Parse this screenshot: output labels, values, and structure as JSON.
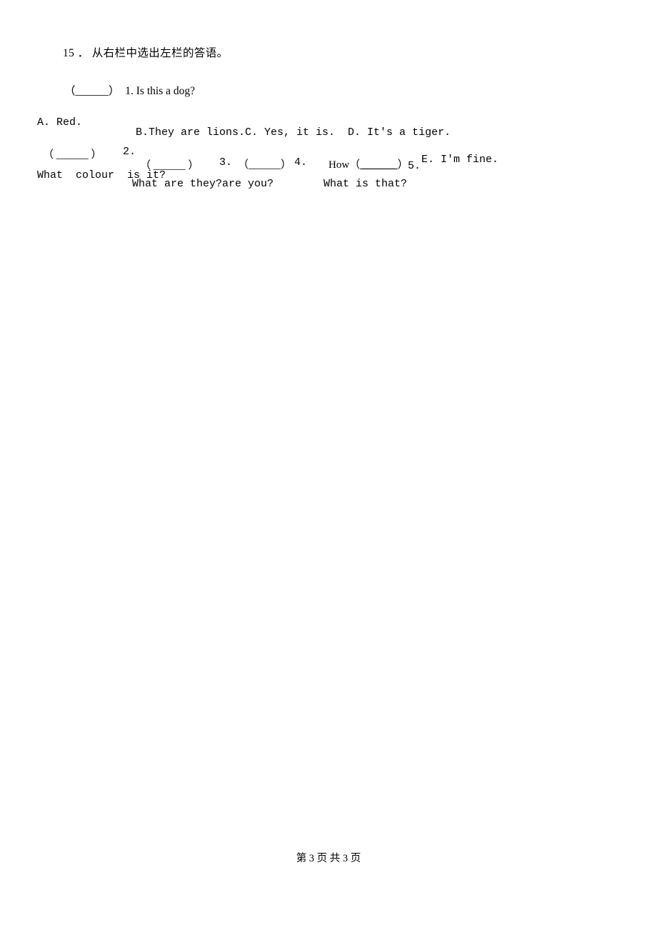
{
  "page": {
    "question_number_title": "15 ． 从右栏中选出左栏的答语。",
    "footer": "第 3 页 共 3 页"
  },
  "items": [
    {
      "paren": "（______）",
      "number": "1.",
      "text": "Is this a dog?"
    },
    {
      "paren": "（ ______ ）",
      "number": "2.",
      "text": "What  colour  is it?"
    },
    {
      "paren": "（ ______ ）",
      "number": "3.",
      "text": "What are they?"
    },
    {
      "paren": "（______）",
      "number": "4.",
      "text_before": "How（",
      "blank": " ______ ",
      "text_after": "）",
      "text": "are you?"
    },
    {
      "paren": "",
      "number": "5.",
      "text": "What is that?"
    }
  ],
  "options": {
    "a": "A. Red.",
    "bcd": "B.They are lions.C. Yes, it is.  D. It's a tiger.",
    "e": "E. I'm fine."
  }
}
